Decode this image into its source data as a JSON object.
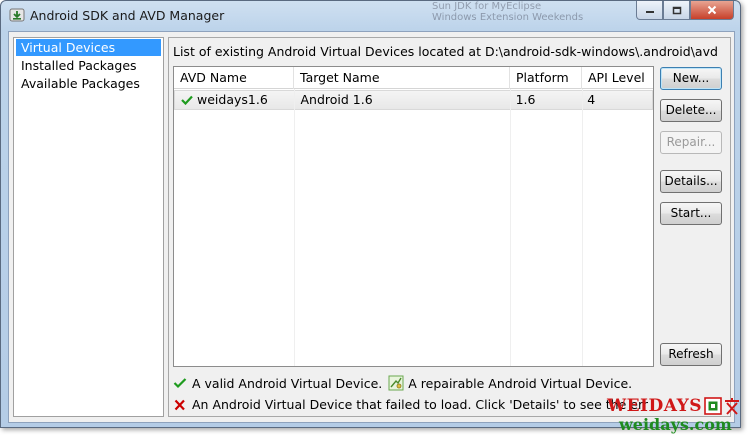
{
  "window": {
    "title": "Android SDK and AVD Manager",
    "background_window_text": [
      "Sun JDK for MyEclipse",
      "Windows Extension Weekends"
    ]
  },
  "nav": {
    "items": [
      {
        "label": "Virtual Devices",
        "selected": true
      },
      {
        "label": "Installed Packages",
        "selected": false
      },
      {
        "label": "Available Packages",
        "selected": false
      }
    ]
  },
  "main": {
    "caption": "List of existing Android Virtual Devices located at D:\\android-sdk-windows\\.android\\avd",
    "columns": [
      "AVD Name",
      "Target Name",
      "Platform",
      "API Level"
    ],
    "rows": [
      {
        "status_icon": "check-icon",
        "name": "weidays1.6",
        "target": "Android 1.6",
        "platform": "1.6",
        "api": "4"
      }
    ]
  },
  "buttons": {
    "new": "New...",
    "delete": "Delete...",
    "repair": "Repair...",
    "details": "Details...",
    "start": "Start...",
    "refresh": "Refresh"
  },
  "legend": {
    "valid": "A valid Android Virtual Device.",
    "repairable": "A repairable Android Virtual Device.",
    "failed": "An Android Virtual Device that failed to load. Click 'Details' to see the err"
  },
  "watermark": {
    "top": "WEIDAYS",
    "bottom": "weidays.com"
  },
  "colors": {
    "selection": "#3399ff",
    "valid_icon": "#1e9b1e",
    "error_icon": "#cc0000",
    "watermark_red": "#d01818",
    "watermark_green": "#1f8b1f"
  }
}
